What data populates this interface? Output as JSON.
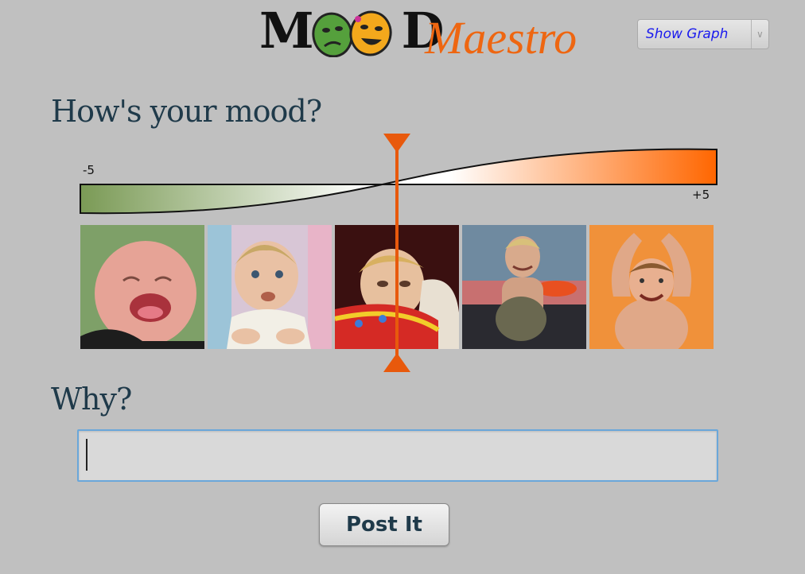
{
  "app": {
    "logo_word": "MOOD",
    "logo_left": "M",
    "logo_right": "D",
    "logo_script": "Maestro"
  },
  "graph_toggle": {
    "selected": "Show Graph"
  },
  "mood": {
    "question": "How's your mood?",
    "min_label": "-5",
    "max_label": "+5",
    "min": -5,
    "max": 5,
    "value": 0,
    "faces": [
      "crying-baby-photo",
      "messy-baby-photo",
      "neutral-baby-photo",
      "smiling-boy-photo",
      "cheering-boy-photo"
    ]
  },
  "why": {
    "question": "Why?",
    "value": "",
    "placeholder": ""
  },
  "post_button": {
    "label": "Post It"
  },
  "colors": {
    "accent": "#e8590c",
    "negative": "#7a9a55",
    "positive": "#ff6600",
    "background": "#c0c0c0"
  }
}
